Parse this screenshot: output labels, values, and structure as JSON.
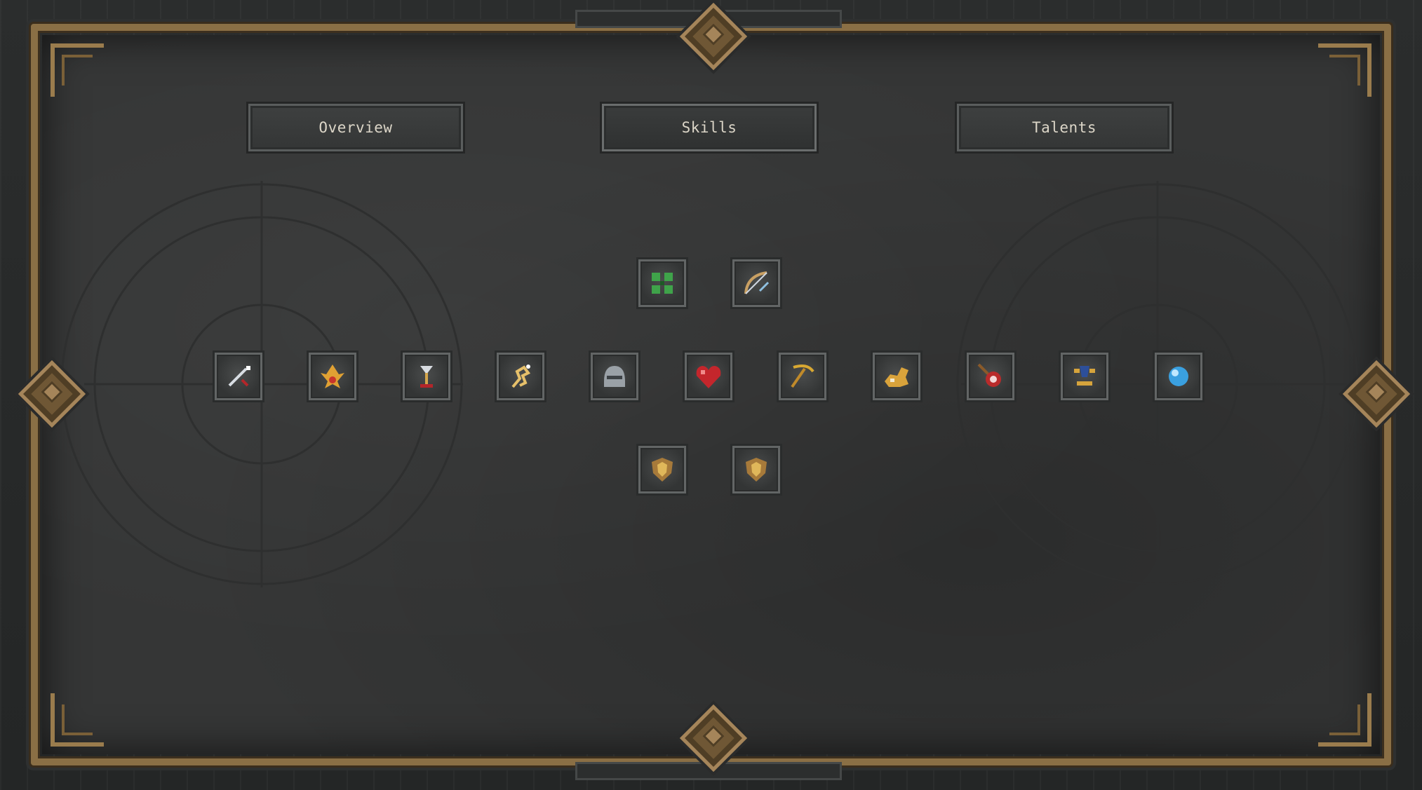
{
  "tabs": [
    {
      "label": "Overview"
    },
    {
      "label": "Skills"
    },
    {
      "label": "Talents"
    }
  ],
  "active_tab": "Skills",
  "skills_top_row": [
    {
      "icon": "clover-icon"
    },
    {
      "icon": "bow-icon"
    }
  ],
  "skills_middle_row": [
    {
      "icon": "sword-icon"
    },
    {
      "icon": "fire-bird-icon"
    },
    {
      "icon": "goblet-icon"
    },
    {
      "icon": "leaping-figure-icon"
    },
    {
      "icon": "helmet-icon"
    },
    {
      "icon": "heart-icon"
    },
    {
      "icon": "pickaxe-icon"
    },
    {
      "icon": "golden-beast-icon"
    },
    {
      "icon": "target-wand-icon"
    },
    {
      "icon": "anvil-trophy-icon"
    },
    {
      "icon": "blue-orb-icon"
    }
  ],
  "skills_bottom_row": [
    {
      "icon": "shield-icon"
    },
    {
      "icon": "shield-icon"
    }
  ],
  "colors": {
    "frame_bronze": "#8a6f45",
    "panel_stone": "#353636",
    "tab_text": "#dcd6c8"
  }
}
